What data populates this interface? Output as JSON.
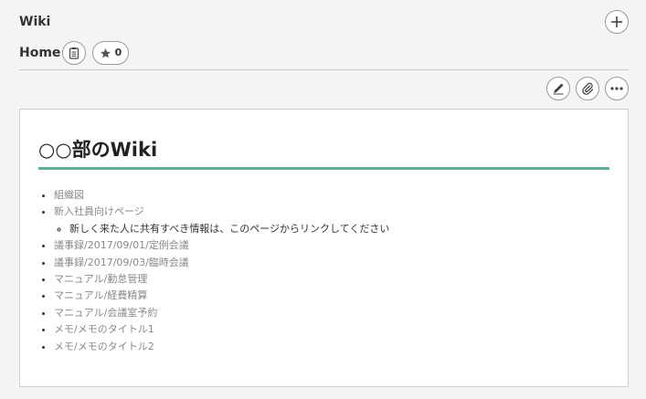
{
  "app": {
    "title": "Wiki"
  },
  "page": {
    "title": "Home",
    "star_count": "0"
  },
  "content": {
    "heading": "○○部のWiki",
    "items": [
      {
        "label": "組織図"
      },
      {
        "label": "新入社員向けページ",
        "children": [
          {
            "label": "新しく来た人に共有すべき情報は、このページからリンクしてください"
          }
        ]
      },
      {
        "label": "議事録/2017/09/01/定例会議"
      },
      {
        "label": "議事録/2017/09/03/臨時会議"
      },
      {
        "label": "マニュアル/勤怠管理"
      },
      {
        "label": "マニュアル/経費精算"
      },
      {
        "label": "マニュアル/会議室予約"
      },
      {
        "label": "メモ/メモのタイトル1"
      },
      {
        "label": "メモ/メモのタイトル2"
      }
    ]
  },
  "icons": {
    "add": "plus-icon",
    "page_list": "clipboard-icon",
    "star": "star-icon",
    "edit": "pencil-icon",
    "attach": "paperclip-icon",
    "more": "ellipsis-icon"
  },
  "colors": {
    "heading_rule": "#5fae8f",
    "link_text": "#888888"
  }
}
